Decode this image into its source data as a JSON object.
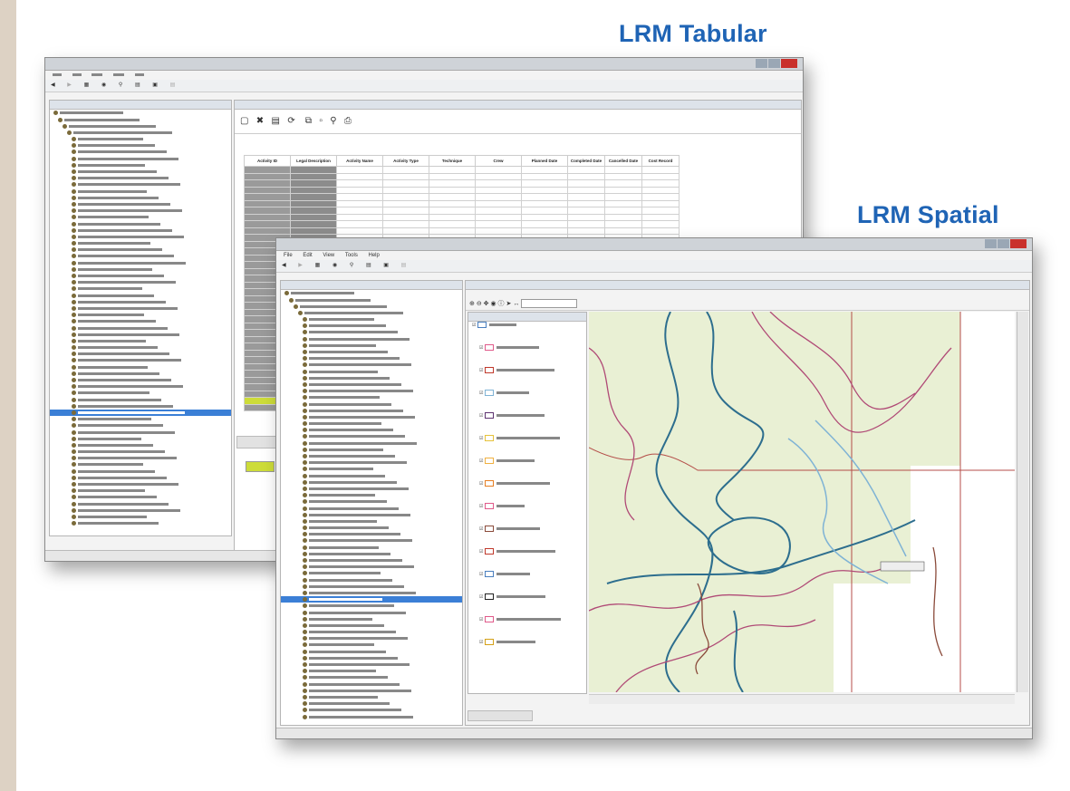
{
  "headings": {
    "tabular": "LRM Tabular",
    "spatial": "LRM Spatial"
  },
  "colors": {
    "heading_blue": "#1f64b5",
    "selection_blue": "#3b7fd6",
    "map_land": "#e9f0d4",
    "map_blue": "#2d6e8e",
    "map_pink": "#b04a76",
    "map_brown": "#8a4a3a",
    "map_light_blue": "#7fb3d5"
  },
  "tabular_window": {
    "icons": [
      "back-icon",
      "forward-icon",
      "tabular-icon",
      "spatial-icon",
      "search-icon",
      "reports-icon",
      "maps-icon",
      "query-builder-icon"
    ],
    "table": {
      "columns": [
        "Activity ID",
        "Legal Description",
        "Activity Name",
        "Activity Type",
        "Technique",
        "Crew",
        "Planned Date",
        "Completed Date",
        "Cancelled Date",
        "Cost Record"
      ]
    }
  },
  "spatial_window": {
    "menu": [
      "File",
      "Edit",
      "View",
      "Tools",
      "Help"
    ],
    "legend_layers": [
      "Treatments",
      "Townships",
      "Forest Activity Areas",
      "Site Preparation"
    ]
  }
}
